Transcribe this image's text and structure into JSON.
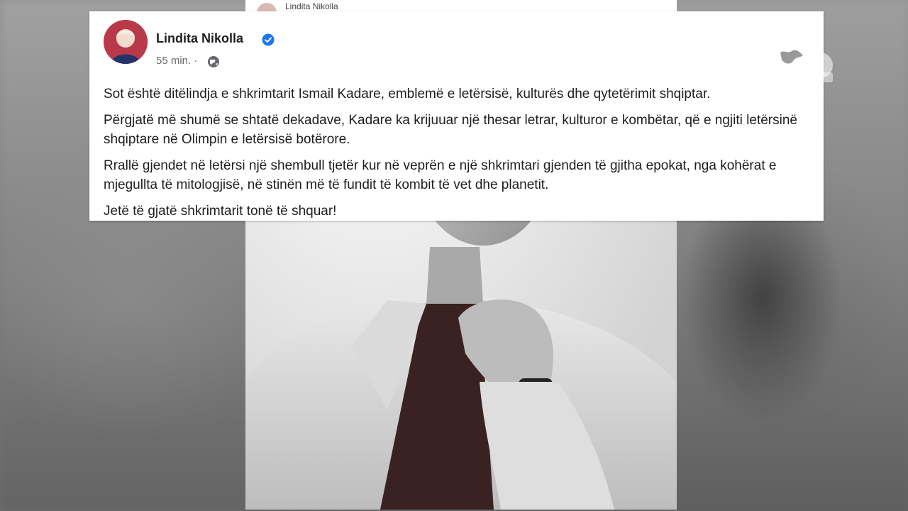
{
  "post": {
    "author": "Lindita Nikolla",
    "time": "55 min.",
    "separator": "·",
    "paragraphs": [
      "Sot është ditëlindja e shkrimtarit Ismail Kadare, emblemë e letërsisë, kulturës  dhe qytetërimit shqiptar.",
      "Përgjatë më shumë se shtatë dekadave, Kadare ka krijuuar një thesar letrar, kulturor e kombëtar, që e ngjiti letërsinë shqiptare në Olimpin e letërsisë botërore.",
      "Rrallë gjendet në letërsi një shembull tjetër kur në veprën e një shkrimtari gjenden të gjitha epokat, nga kohërat e mjegullta të mitologjisë, në stinën më të fundit të kombit të vet dhe planetit.",
      "Jetë të gjatë shkrimtarit tonë të shquar!"
    ],
    "verified_icon": "verified-badge-icon",
    "audience_icon": "globe-icon"
  },
  "back_post": {
    "author": "Lindita Nikolla"
  },
  "photo": {
    "subject": "portrait-photo"
  },
  "channel_logo": {
    "icon": "channel-logo-icon"
  },
  "colors": {
    "verified": "#1877f2",
    "meta_text": "#65676b",
    "card_bg": "#ffffff"
  }
}
